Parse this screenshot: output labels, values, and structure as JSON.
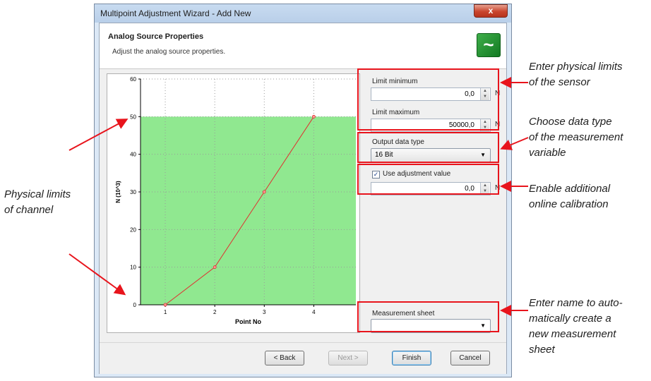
{
  "window": {
    "title": "Multipoint Adjustment Wizard - Add New",
    "close_glyph": "x"
  },
  "header": {
    "title": "Analog Source Properties",
    "subtitle": "Adjust the analog source properties.",
    "logo_icon": "analog-wave-icon",
    "logo_glyph": "~"
  },
  "chart_data": {
    "type": "line",
    "x": [
      1,
      2,
      3,
      4
    ],
    "y": [
      0,
      10,
      30,
      50
    ],
    "xlabel": "Point No",
    "ylabel": "N (10^3)",
    "xticks": [
      "1",
      "2",
      "3",
      "4"
    ],
    "yticks": [
      "0",
      "10",
      "20",
      "30",
      "40",
      "50",
      "60"
    ],
    "xlim": [
      0.5,
      4.85
    ],
    "ylim": [
      0,
      60
    ],
    "grid": true,
    "shaded_range": [
      0,
      50
    ],
    "shade_color": "#90e890",
    "line_color": "#e03030"
  },
  "form": {
    "limit_min_label": "Limit minimum",
    "limit_min_value": "0,0",
    "limit_max_label": "Limit maximum",
    "limit_max_value": "50000,0",
    "unit": "N",
    "output_type_label": "Output data type",
    "output_type_value": "16 Bit",
    "use_adjustment_label": "Use adjustment value",
    "use_adjustment_checked": true,
    "adjustment_value": "0,0",
    "measurement_sheet_label": "Measurement sheet",
    "measurement_sheet_value": ""
  },
  "buttons": {
    "back": "< Back",
    "next": "Next >",
    "finish": "Finish",
    "cancel": "Cancel"
  },
  "annotations": {
    "limits": [
      "Enter physical limits",
      "of the sensor"
    ],
    "data_type": [
      "Choose data type",
      "of the measurement",
      "variable"
    ],
    "calibration": [
      "Enable additional",
      "online calibration"
    ],
    "sheet": [
      "Enter name to auto-",
      "matically create a",
      "new measurement",
      "sheet"
    ],
    "channel": [
      "Physical limits",
      "of channel"
    ]
  },
  "colors": {
    "annotation_red": "#e8141c"
  }
}
